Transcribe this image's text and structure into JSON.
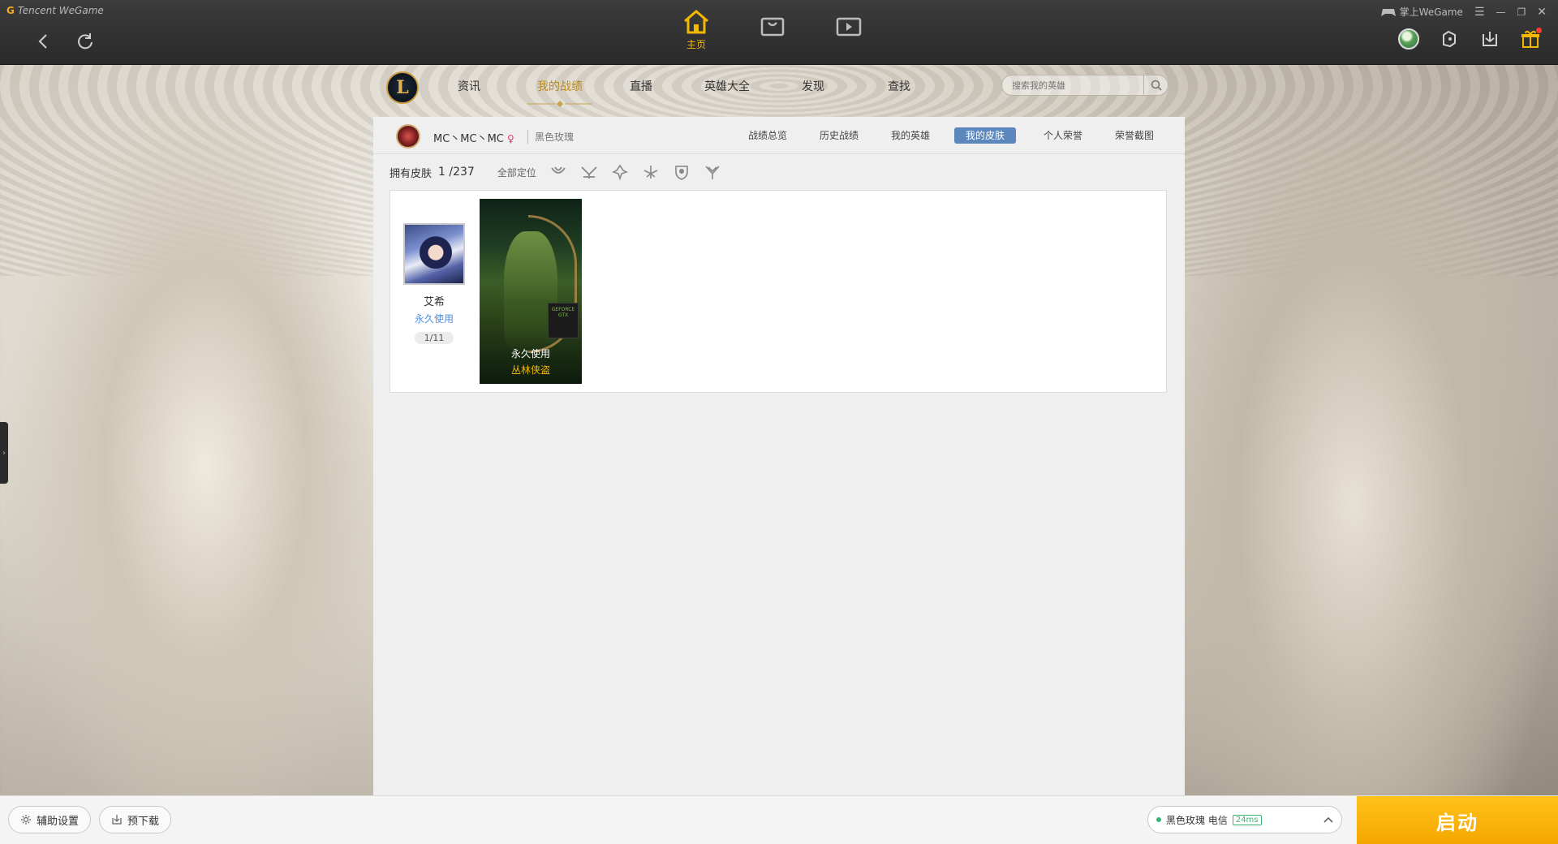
{
  "app": {
    "brand_text": "Tencent WeGame",
    "user_label": "掌上WeGame"
  },
  "top_tabs": [
    {
      "label": "主页",
      "icon": "home-icon",
      "active": true
    },
    {
      "icon": "store-icon"
    },
    {
      "icon": "video-icon"
    }
  ],
  "game_nav": {
    "items": [
      {
        "label": "资讯"
      },
      {
        "label": "我的战绩",
        "active": true
      },
      {
        "label": "直播"
      },
      {
        "label": "英雄大全"
      },
      {
        "label": "发现"
      },
      {
        "label": "查找"
      }
    ],
    "search_placeholder": "搜索我的英雄"
  },
  "profile": {
    "name": "MC丶MC丶MC",
    "gender_symbol": "♀",
    "server": "黑色玫瑰",
    "tabs": [
      {
        "label": "战绩总览"
      },
      {
        "label": "历史战绩"
      },
      {
        "label": "我的英雄"
      },
      {
        "label": "我的皮肤",
        "active": true
      },
      {
        "label": "个人荣誉"
      },
      {
        "label": "荣誉截图"
      }
    ]
  },
  "skins": {
    "owned_label": "拥有皮肤",
    "owned_count": "1 /237",
    "filter_all": "全部定位",
    "role_icons": [
      "mage-icon",
      "fighter-icon",
      "tank-icon",
      "assassin-icon",
      "support-icon",
      "marksman-icon"
    ],
    "champion": {
      "name": "艾希",
      "status": "永久使用",
      "count": "1/11"
    },
    "skin_card": {
      "status": "永久使用",
      "name": "丛林侠盗",
      "badge_text": "GEFORCE GTX"
    }
  },
  "bottom": {
    "assist_settings": "辅助设置",
    "predownload": "预下载",
    "server_name": "黑色玫瑰 电信",
    "ping": "24ms",
    "launch": "启动"
  },
  "colors": {
    "accent": "#f5b800",
    "active_tab": "#5b87bc",
    "launch": "#f4a600",
    "topbar": "#2e2e2e"
  }
}
